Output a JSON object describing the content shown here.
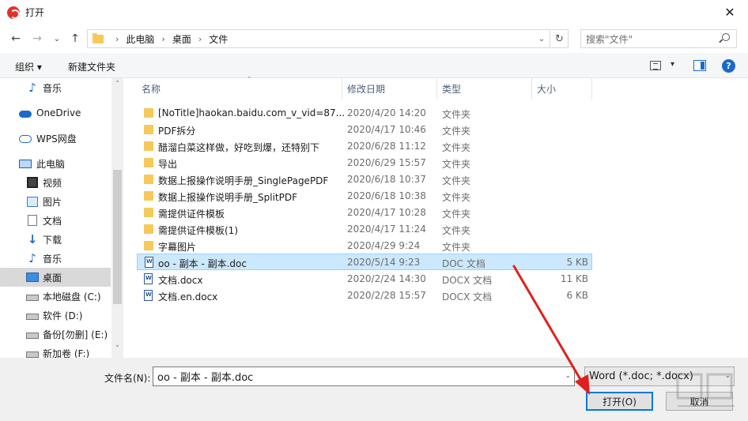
{
  "window": {
    "title": "打开",
    "close_glyph": "✕"
  },
  "address": {
    "crumbs": [
      "此电脑",
      "桌面",
      "文件"
    ],
    "search_placeholder": "搜索\"文件\""
  },
  "toolbar": {
    "organize": "组织 ▾",
    "new_folder": "新建文件夹"
  },
  "nav": {
    "items": [
      {
        "label": "音乐",
        "icon": "music-note-icon"
      },
      {
        "label": "OneDrive",
        "icon": "cloud-icon"
      },
      {
        "label": "WPS网盘",
        "icon": "wps-cloud-icon"
      },
      {
        "label": "此电脑",
        "icon": "computer-icon"
      },
      {
        "label": "视频",
        "icon": "video-icon"
      },
      {
        "label": "图片",
        "icon": "pictures-icon"
      },
      {
        "label": "文档",
        "icon": "documents-icon"
      },
      {
        "label": "下载",
        "icon": "download-icon"
      },
      {
        "label": "音乐",
        "icon": "music-note-icon"
      },
      {
        "label": "桌面",
        "icon": "desktop-icon"
      },
      {
        "label": "本地磁盘 (C:)",
        "icon": "drive-icon"
      },
      {
        "label": "软件 (D:)",
        "icon": "drive-icon"
      },
      {
        "label": "备份[勿删] (E:)",
        "icon": "drive-icon"
      },
      {
        "label": "新加卷 (F:)",
        "icon": "drive-icon"
      }
    ]
  },
  "columns": {
    "name": "名称",
    "modified": "修改日期",
    "type": "类型",
    "size": "大小"
  },
  "files": [
    {
      "name": "[NoTitle]haokan.baidu.com_v_vid=87...",
      "date": "2020/4/20 14:20",
      "type": "文件夹",
      "size": ""
    },
    {
      "name": "PDF拆分",
      "date": "2020/4/17 10:46",
      "type": "文件夹",
      "size": ""
    },
    {
      "name": "醋溜白菜这样做，好吃到爆，还特别下",
      "date": "2020/6/28 11:12",
      "type": "文件夹",
      "size": ""
    },
    {
      "name": "导出",
      "date": "2020/6/29 15:57",
      "type": "文件夹",
      "size": ""
    },
    {
      "name": "数据上报操作说明手册_SinglePagePDF",
      "date": "2020/6/18 10:37",
      "type": "文件夹",
      "size": ""
    },
    {
      "name": "数据上报操作说明手册_SplitPDF",
      "date": "2020/6/18 10:38",
      "type": "文件夹",
      "size": ""
    },
    {
      "name": "需提供证件模板",
      "date": "2020/4/17 10:28",
      "type": "文件夹",
      "size": ""
    },
    {
      "name": "需提供证件模板(1)",
      "date": "2020/4/17 11:24",
      "type": "文件夹",
      "size": ""
    },
    {
      "name": "字幕图片",
      "date": "2020/4/29 9:24",
      "type": "文件夹",
      "size": ""
    },
    {
      "name": "oo - 副本 - 副本.doc",
      "date": "2020/5/14 9:23",
      "type": "DOC 文档",
      "size": "5 KB"
    },
    {
      "name": "文档.docx",
      "date": "2020/2/24 14:30",
      "type": "DOCX 文档",
      "size": "11 KB"
    },
    {
      "name": "文档.en.docx",
      "date": "2020/2/28 15:57",
      "type": "DOCX 文档",
      "size": "6 KB"
    }
  ],
  "bottom": {
    "filename_label": "文件名(N):",
    "filename_value": "oo - 副本 - 副本.doc",
    "filter_value": "Word (*.doc; *.docx)",
    "open_label": "打开(O)",
    "cancel_label": "取消"
  },
  "colors": {
    "accent": "#0078d7",
    "selection": "#cce8ff",
    "annotation_arrow": "#e0201e"
  }
}
